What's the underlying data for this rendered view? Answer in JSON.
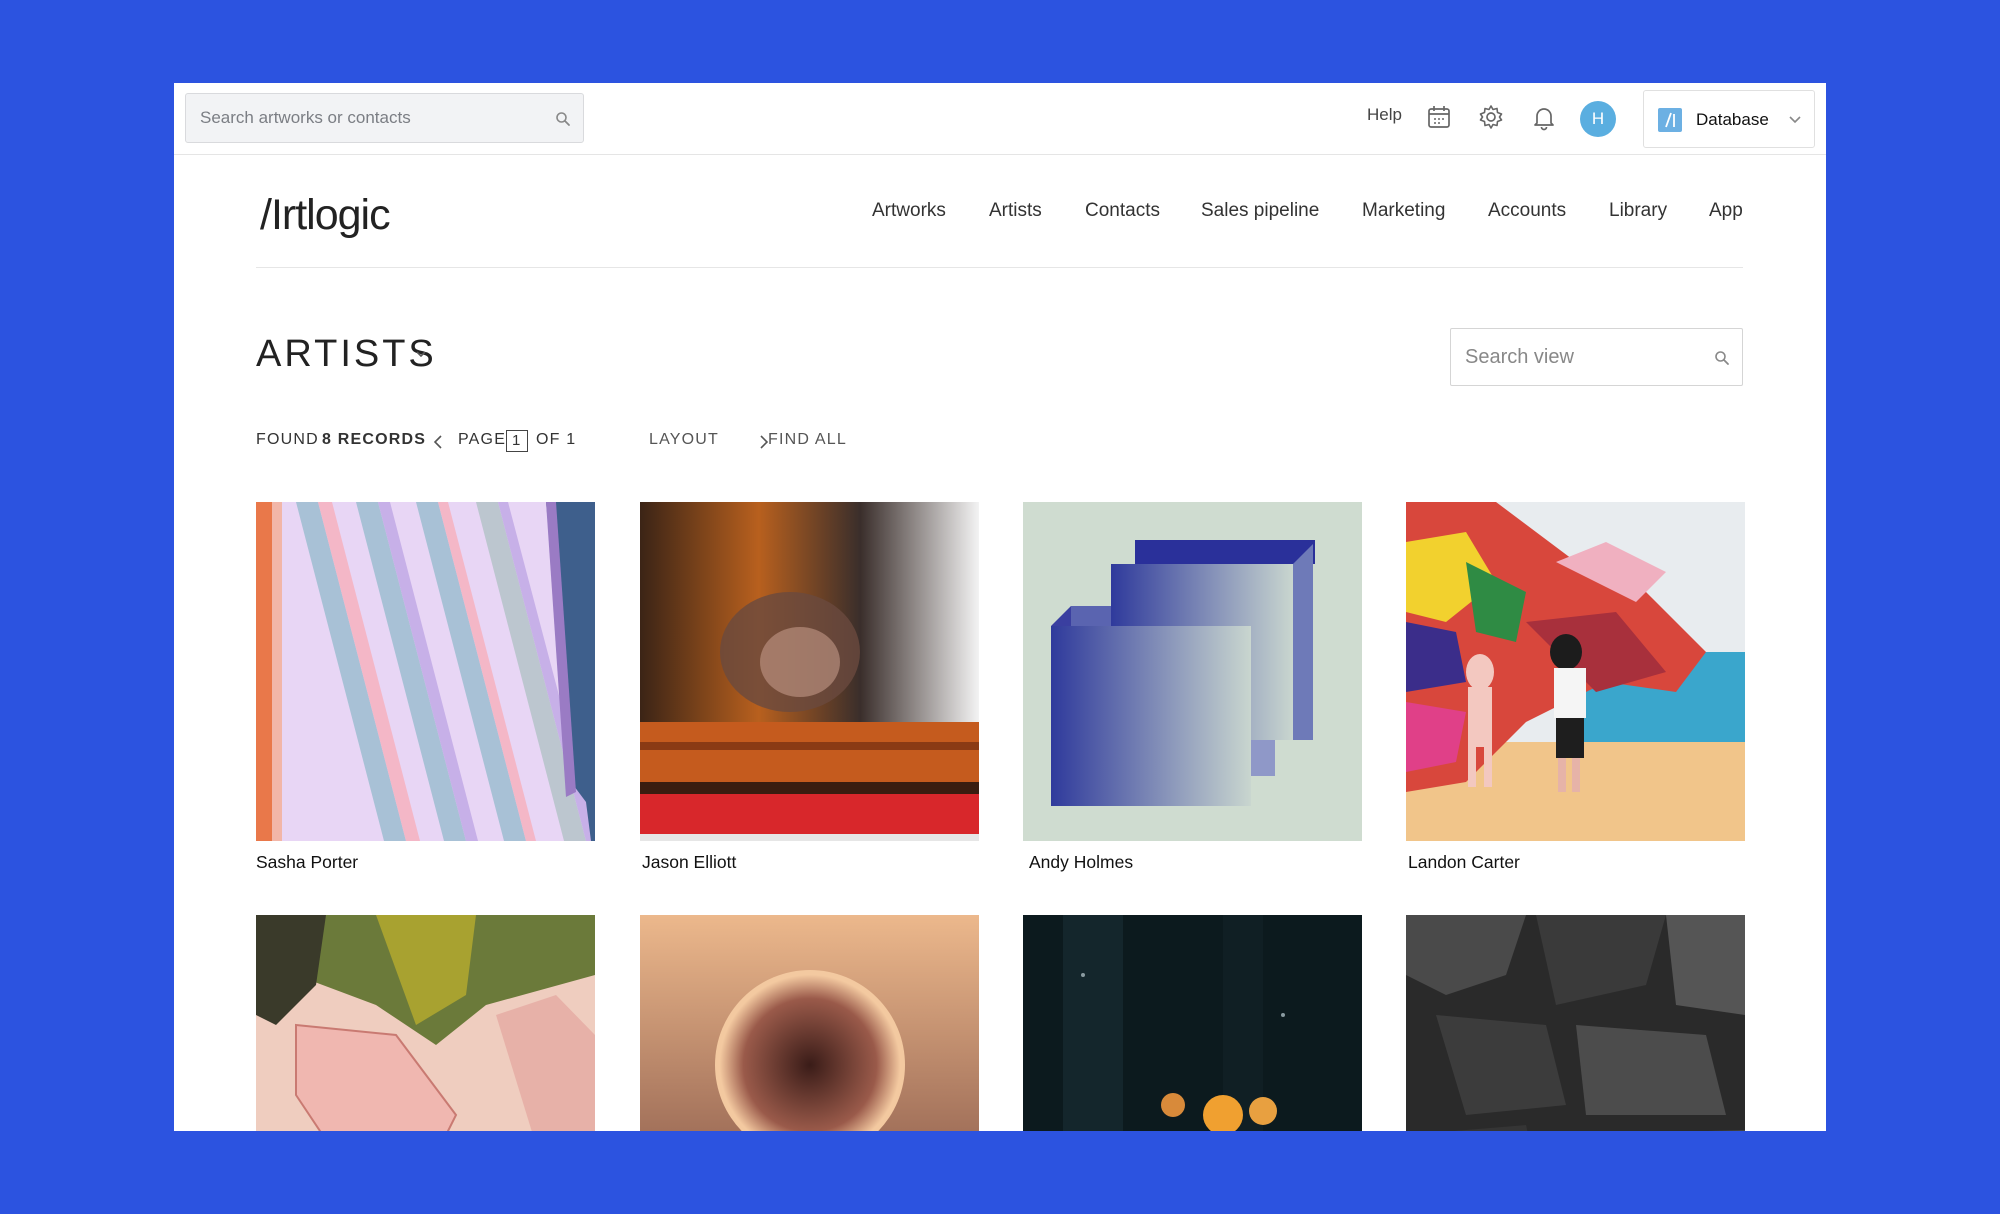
{
  "topbar": {
    "search_placeholder": "Search artworks or contacts",
    "help_label": "Help",
    "avatar_initial": "H",
    "database_label": "Database",
    "icons": [
      "search-icon",
      "calendar-icon",
      "gear-icon",
      "bell-icon",
      "chevron-down-icon"
    ]
  },
  "brand": {
    "logo": "/Irtlogic"
  },
  "nav": {
    "items": [
      "Artworks",
      "Artists",
      "Contacts",
      "Sales pipeline",
      "Marketing",
      "Accounts",
      "Library",
      "App"
    ]
  },
  "page": {
    "title": "ARTISTS",
    "search_placeholder": "Search view"
  },
  "records": {
    "found_label": "FOUND",
    "count": "8 RECORDS",
    "page_label": "PAGE",
    "page_current": "1",
    "page_of": "OF 1",
    "layout_label": "LAYOUT",
    "find_all_label": "FIND ALL"
  },
  "artists": [
    {
      "name": "Sasha Porter"
    },
    {
      "name": "Jason Elliott"
    },
    {
      "name": "Andy Holmes"
    },
    {
      "name": "Landon Carter"
    },
    {
      "name": ""
    },
    {
      "name": ""
    },
    {
      "name": ""
    },
    {
      "name": ""
    }
  ],
  "colors": {
    "background": "#2c53e0",
    "avatar": "#5aaee0",
    "db_logo": "#6cb0e3"
  }
}
